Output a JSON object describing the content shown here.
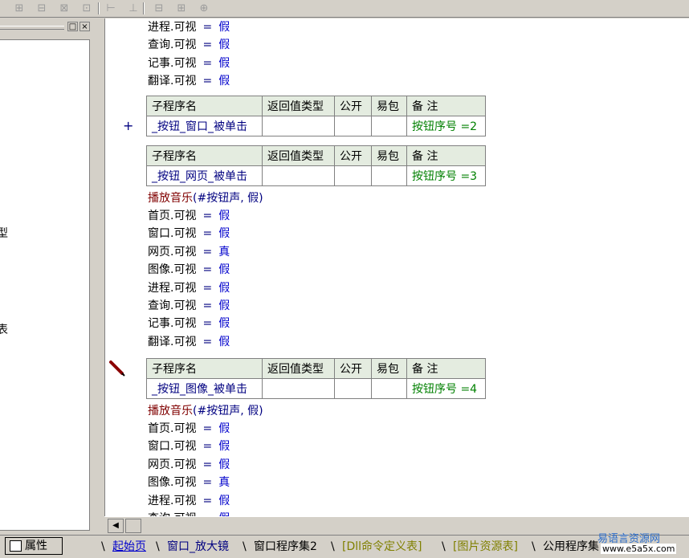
{
  "colors": {
    "accent": "#000080",
    "value": "#0000cc",
    "remark": "#008000",
    "call": "#800000",
    "table_header_bg": "#e4ece0"
  },
  "toolbar": {
    "icons": [
      "align-left-icon",
      "align-center-icon",
      "align-top-icon",
      "align-middle-icon",
      "spacing-h-icon",
      "spacing-v-icon",
      "same-width-icon",
      "same-height-icon",
      "same-size-icon"
    ]
  },
  "left_panel": {
    "fragments": [
      "型",
      "表"
    ],
    "restore_label": "□",
    "close_label": "×"
  },
  "editor": {
    "block1": [
      {
        "obj": "进程.可视",
        "eq": "=",
        "val": "假"
      },
      {
        "obj": "查询.可视",
        "eq": "=",
        "val": "假"
      },
      {
        "obj": "记事.可视",
        "eq": "=",
        "val": "假"
      },
      {
        "obj": "翻译.可视",
        "eq": "=",
        "val": "假"
      }
    ],
    "table_headers": [
      "子程序名",
      "返回值类型",
      "公开",
      "易包",
      "备 注"
    ],
    "sub1": {
      "name": "_按钮_窗口_被单击",
      "remark": "按钮序号 =2"
    },
    "sub2": {
      "name": "_按钮_网页_被单击",
      "remark": "按钮序号 =3"
    },
    "call1": {
      "func": "播放音乐",
      "args": "(#按钮声, 假)"
    },
    "block2": [
      {
        "obj": "首页.可视",
        "eq": "=",
        "val": "假"
      },
      {
        "obj": "窗口.可视",
        "eq": "=",
        "val": "假"
      },
      {
        "obj": "网页.可视",
        "eq": "=",
        "val": "真"
      },
      {
        "obj": "图像.可视",
        "eq": "=",
        "val": "假"
      },
      {
        "obj": "进程.可视",
        "eq": "=",
        "val": "假"
      },
      {
        "obj": "查询.可视",
        "eq": "=",
        "val": "假"
      },
      {
        "obj": "记事.可视",
        "eq": "=",
        "val": "假"
      },
      {
        "obj": "翻译.可视",
        "eq": "=",
        "val": "假"
      }
    ],
    "sub3": {
      "name": "_按钮_图像_被单击",
      "remark": "按钮序号 =4"
    },
    "call2": {
      "func": "播放音乐",
      "args": "(#按钮声, 假)"
    },
    "block3": [
      {
        "obj": "首页.可视",
        "eq": "=",
        "val": "假"
      },
      {
        "obj": "窗口.可视",
        "eq": "=",
        "val": "假"
      },
      {
        "obj": "网页.可视",
        "eq": "=",
        "val": "假"
      },
      {
        "obj": "图像.可视",
        "eq": "=",
        "val": "真"
      },
      {
        "obj": "进程.可视",
        "eq": "=",
        "val": "假"
      },
      {
        "obj": "查询.可视",
        "eq": "=",
        "val": "假"
      }
    ],
    "plus_label": "+"
  },
  "bottom": {
    "properties_tab": "属性",
    "tabs": [
      {
        "label": "起始页",
        "color": "#0000cc"
      },
      {
        "label": "窗口_放大镜",
        "color": "#000080"
      },
      {
        "label": "窗口程序集2",
        "color": "#000000"
      },
      {
        "label": "[Dll命令定义表]",
        "color": "#808000"
      },
      {
        "label": "[图片资源表]",
        "color": "#808000"
      },
      {
        "label": "公用程序集",
        "color": "#000000"
      }
    ],
    "scroll_left": "◀"
  },
  "watermark": {
    "line1": "易语言资源网",
    "line2": "www.e5a5x.com"
  }
}
